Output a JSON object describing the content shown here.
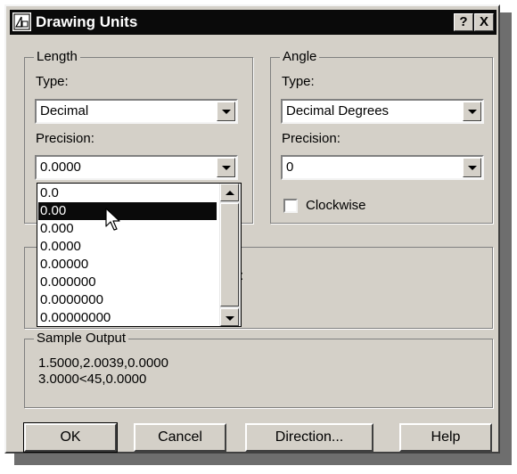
{
  "title": "Drawing Units",
  "title_buttons": {
    "help": "?",
    "close": "X"
  },
  "length": {
    "group_label": "Length",
    "type_label": "Type:",
    "type_value": "Decimal",
    "precision_label": "Precision:",
    "precision_value": "0.0000",
    "precision_options": [
      "0.0",
      "0.00",
      "0.000",
      "0.0000",
      "0.00000",
      "0.000000",
      "0.0000000",
      "0.00000000"
    ],
    "highlighted_option": "0.00"
  },
  "angle": {
    "group_label": "Angle",
    "type_label": "Type:",
    "type_value": "Decimal Degrees",
    "precision_label": "Precision:",
    "precision_value": "0",
    "clockwise_label": "Clockwise",
    "clockwise_checked": false
  },
  "insertion": {
    "partial_text": ":"
  },
  "sample_output": {
    "group_label": "Sample Output",
    "line1": "1.5000,2.0039,0.0000",
    "line2": "3.0000<45,0.0000"
  },
  "buttons": {
    "ok": "OK",
    "cancel": "Cancel",
    "direction": "Direction...",
    "help": "Help"
  },
  "icons": {
    "title": "drawing-units-app-icon",
    "cursor": "mouse-pointer-icon"
  }
}
